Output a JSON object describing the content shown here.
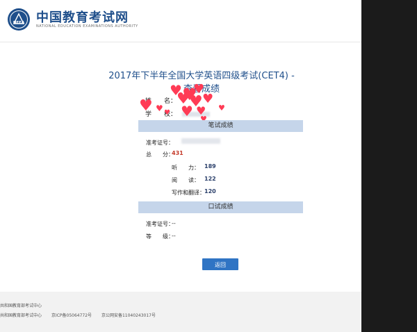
{
  "header": {
    "site_name": "中国教育考试网",
    "site_subtitle": "NATIONAL EDUCATION EXAMINATIONS AUTHORITY",
    "logo_text": "NEEA"
  },
  "page_title": "2017年下半年全国大学英语四级考试(CET4) - 查看成绩",
  "candidate": {
    "name_label": "姓　　名：",
    "school_label": "学　　校："
  },
  "written": {
    "section_title": "笔试成绩",
    "ticket_label": "准考证号：",
    "total_label": "总　　分：",
    "total_value": "431",
    "listening_label": "听　　力：",
    "listening_value": "189",
    "reading_label": "阅　　读：",
    "reading_value": "122",
    "writing_label": "写作和翻译：",
    "writing_value": "120"
  },
  "oral": {
    "section_title": "口试成绩",
    "ticket_label": "准考证号：",
    "ticket_value": "--",
    "grade_label": "等　　级：",
    "grade_value": "--"
  },
  "actions": {
    "back_label": "返回"
  },
  "footer": {
    "line1": "共和国教育部考试中心",
    "line2_org": "共和国教育部考试中心",
    "line2_icp": "京ICP备05064772号",
    "line2_police": "京公网安备11040243017号"
  },
  "colors": {
    "brand": "#1f4f8b",
    "section_header_bg": "#c5d5ea",
    "score_value": "#2a3f6a",
    "total_score": "#c43a2a",
    "button": "#2f74c4",
    "heart": "#ff3b55"
  }
}
